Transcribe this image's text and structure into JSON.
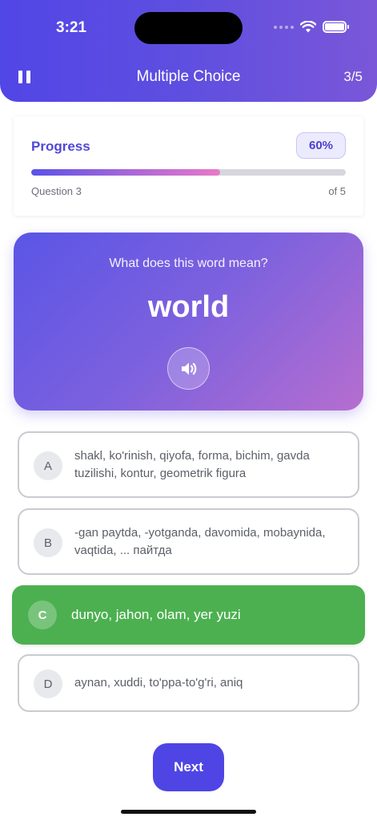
{
  "status": {
    "time": "3:21"
  },
  "header": {
    "title": "Multiple Choice",
    "counter": "3/5"
  },
  "progress": {
    "label": "Progress",
    "percent_text": "60%",
    "value": 0.6,
    "question_text": "Question 3",
    "of_text": "of 5"
  },
  "question": {
    "prompt": "What does this word mean?",
    "word": "world"
  },
  "options": [
    {
      "letter": "A",
      "text": "shakl, ko'rinish, qiyofa, forma, bichim, gavda tuzilishi, kontur, geometrik figura"
    },
    {
      "letter": "B",
      "text": "-gan paytda, -yotganda, davomida, mobaynida, vaqtida, ... пайтда"
    },
    {
      "letter": "C",
      "text": "dunyo, jahon, olam, yer yuzi",
      "state": "correct"
    },
    {
      "letter": "D",
      "text": "aynan, xuddi, to'ppa-to'g'ri, aniq"
    }
  ],
  "actions": {
    "next_label": "Next"
  },
  "colors": {
    "accent": "#5146e6",
    "correct": "#4cb050"
  }
}
